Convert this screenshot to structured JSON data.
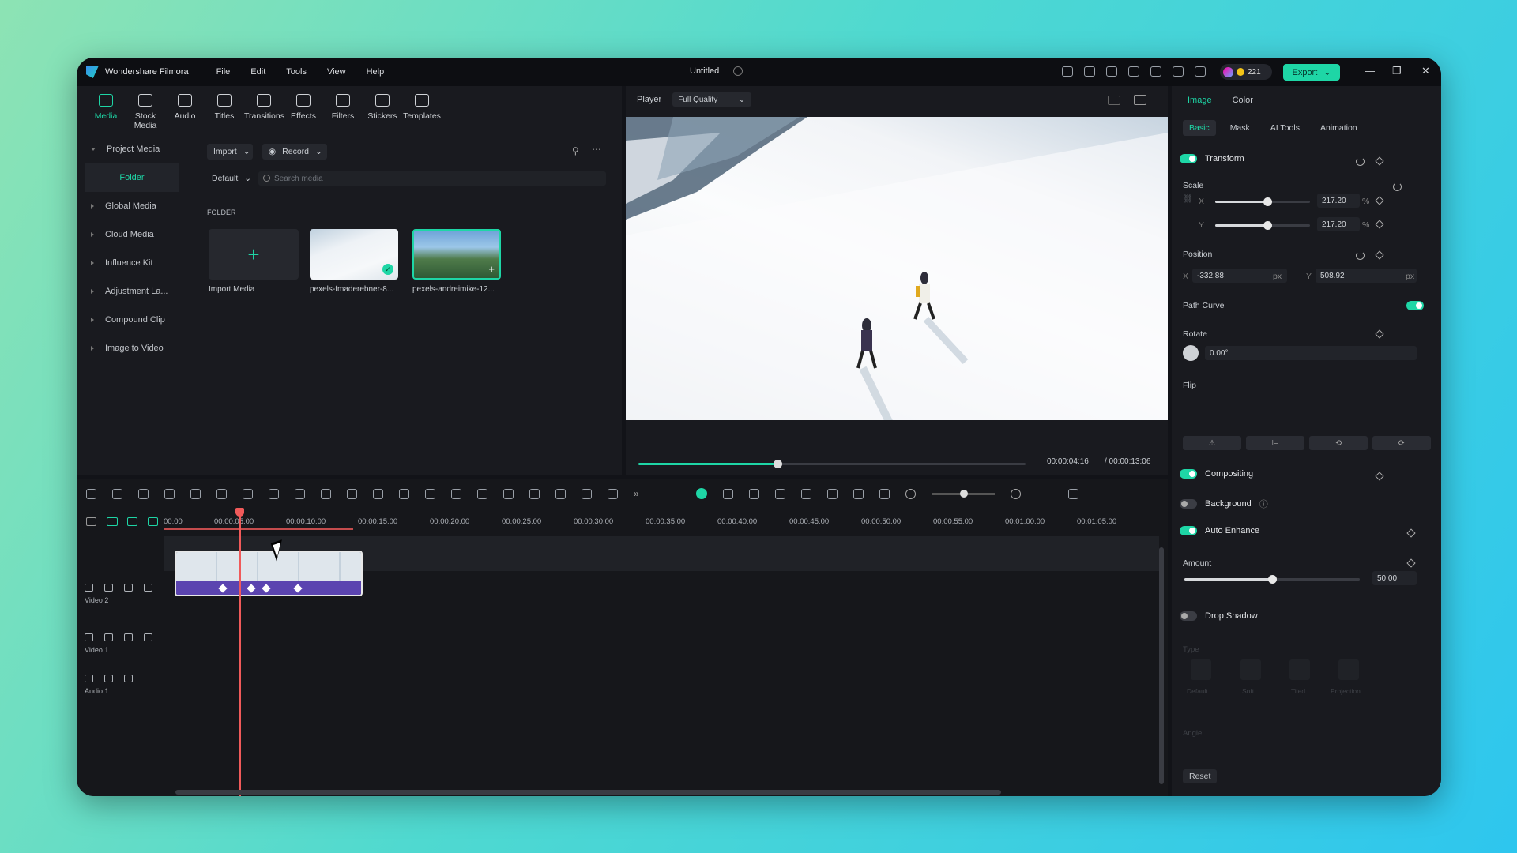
{
  "app": {
    "name": "Wondershare Filmora",
    "doc_title": "Untitled",
    "credits": "221",
    "export_label": "Export"
  },
  "menu": [
    "File",
    "Edit",
    "Tools",
    "View",
    "Help"
  ],
  "toolbar": [
    {
      "label": "Media",
      "icon": "media-icon"
    },
    {
      "label": "Stock Media",
      "icon": "stock-media-icon"
    },
    {
      "label": "Audio",
      "icon": "audio-icon"
    },
    {
      "label": "Titles",
      "icon": "titles-icon"
    },
    {
      "label": "Transitions",
      "icon": "transitions-icon"
    },
    {
      "label": "Effects",
      "icon": "effects-icon"
    },
    {
      "label": "Filters",
      "icon": "filters-icon"
    },
    {
      "label": "Stickers",
      "icon": "stickers-icon"
    },
    {
      "label": "Templates",
      "icon": "templates-icon"
    }
  ],
  "sidebar": {
    "project_media": "Project Media",
    "folder": "Folder",
    "items": [
      "Global Media",
      "Cloud Media",
      "Influence Kit",
      "Adjustment La...",
      "Compound Clip",
      "Image to Video"
    ]
  },
  "media": {
    "import_label": "Import",
    "record_label": "Record",
    "sort_label": "Default",
    "search_placeholder": "Search media",
    "folder_heading": "FOLDER",
    "import_tile_label": "Import Media",
    "items": [
      "pexels-fmaderebner-8...",
      "pexels-andreimike-12..."
    ]
  },
  "player": {
    "label": "Player",
    "quality": "Full Quality",
    "current_time": "00:00:04:16",
    "total_time": "/ 00:00:13:06",
    "progress": 0.36
  },
  "props": {
    "tabs": [
      "Image",
      "Color"
    ],
    "subtabs": [
      "Basic",
      "Mask",
      "AI Tools",
      "Animation"
    ],
    "transform": "Transform",
    "scale": "Scale",
    "scale_x_label": "X",
    "scale_y_label": "Y",
    "scale_x": "217.20",
    "scale_y": "217.20",
    "scale_unit": "%",
    "scale_fraction": 0.55,
    "position": "Position",
    "pos_x_label": "X",
    "pos_x": "-332.88",
    "pos_y_label": "Y",
    "pos_y": "508.92",
    "px_unit": "px",
    "path_curve": "Path Curve",
    "rotate": "Rotate",
    "rotate_value": "0.00°",
    "flip": "Flip",
    "compositing": "Compositing",
    "background": "Background",
    "auto_enhance": "Auto Enhance",
    "amount": "Amount",
    "amount_value": "50.00",
    "amount_fraction": 0.5,
    "drop_shadow": "Drop Shadow",
    "type": "Type",
    "shadow_types": [
      "Default",
      "Soft",
      "Tiled",
      "Projection"
    ],
    "angle": "Angle",
    "reset": "Reset"
  },
  "timeline": {
    "ticks": [
      "00:00",
      "00:00:05:00",
      "00:00:10:00",
      "00:00:15:00",
      "00:00:20:00",
      "00:00:25:00",
      "00:00:30:00",
      "00:00:35:00",
      "00:00:40:00",
      "00:00:45:00",
      "00:00:50:00",
      "00:00:55:00",
      "00:01:00:00",
      "00:01:05:00"
    ],
    "tracks": [
      {
        "num": "2",
        "name": "Video 2"
      },
      {
        "num": "1",
        "name": "Video 1"
      },
      {
        "num": "1",
        "name": "Audio 1"
      }
    ]
  },
  "colors": {
    "accent": "#1ed6a6",
    "clip_keyframes": "#5b44b0",
    "playhead": "#f05a5a"
  }
}
